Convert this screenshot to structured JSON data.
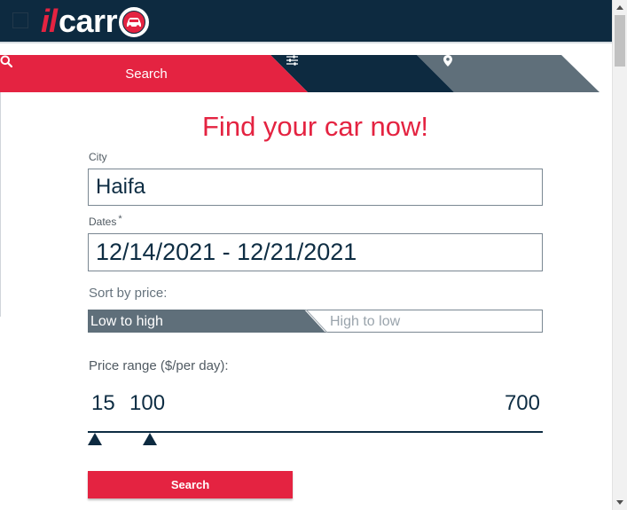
{
  "header": {
    "logo_il": "il",
    "logo_carr": "carr"
  },
  "tabs": [
    {
      "label": "Search",
      "icon": "search-icon",
      "active": true
    },
    {
      "label": "",
      "icon": "sliders-icon",
      "active": false
    },
    {
      "label": "",
      "icon": "map-pin-icon",
      "active": false
    }
  ],
  "form": {
    "title": "Find your car now!",
    "city_label": "City",
    "city_value": "Haifa",
    "dates_label": "Dates",
    "dates_required_mark": "*",
    "dates_value": "12/14/2021 - 12/21/2021",
    "sort_label": "Sort by price:",
    "sort_options": [
      "Low to high",
      "High to low"
    ],
    "sort_selected": "Low to high",
    "price_label": "Price range ($/per day):",
    "price_min": "15",
    "price_max": "100",
    "price_limit": "700",
    "search_button": "Search"
  },
  "colors": {
    "brand_red": "#e42341",
    "navy": "#0d2a40",
    "slate": "#5f6f7a"
  }
}
